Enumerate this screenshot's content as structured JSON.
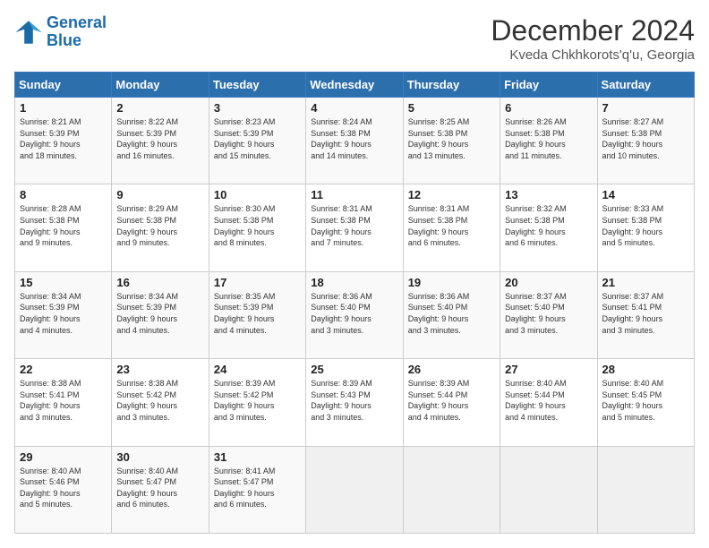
{
  "logo": {
    "general": "General",
    "blue": "Blue"
  },
  "title": "December 2024",
  "subtitle": "Kveda Chkhkorots'q'u, Georgia",
  "days_of_week": [
    "Sunday",
    "Monday",
    "Tuesday",
    "Wednesday",
    "Thursday",
    "Friday",
    "Saturday"
  ],
  "weeks": [
    [
      {
        "day": "1",
        "sunrise": "8:21 AM",
        "sunset": "5:39 PM",
        "daylight_hours": "9",
        "daylight_minutes": "18"
      },
      {
        "day": "2",
        "sunrise": "8:22 AM",
        "sunset": "5:39 PM",
        "daylight_hours": "9",
        "daylight_minutes": "16"
      },
      {
        "day": "3",
        "sunrise": "8:23 AM",
        "sunset": "5:39 PM",
        "daylight_hours": "9",
        "daylight_minutes": "15"
      },
      {
        "day": "4",
        "sunrise": "8:24 AM",
        "sunset": "5:38 PM",
        "daylight_hours": "9",
        "daylight_minutes": "14"
      },
      {
        "day": "5",
        "sunrise": "8:25 AM",
        "sunset": "5:38 PM",
        "daylight_hours": "9",
        "daylight_minutes": "13"
      },
      {
        "day": "6",
        "sunrise": "8:26 AM",
        "sunset": "5:38 PM",
        "daylight_hours": "9",
        "daylight_minutes": "11"
      },
      {
        "day": "7",
        "sunrise": "8:27 AM",
        "sunset": "5:38 PM",
        "daylight_hours": "9",
        "daylight_minutes": "10"
      }
    ],
    [
      {
        "day": "8",
        "sunrise": "8:28 AM",
        "sunset": "5:38 PM",
        "daylight_hours": "9",
        "daylight_minutes": "9"
      },
      {
        "day": "9",
        "sunrise": "8:29 AM",
        "sunset": "5:38 PM",
        "daylight_hours": "9",
        "daylight_minutes": "9"
      },
      {
        "day": "10",
        "sunrise": "8:30 AM",
        "sunset": "5:38 PM",
        "daylight_hours": "9",
        "daylight_minutes": "8"
      },
      {
        "day": "11",
        "sunrise": "8:31 AM",
        "sunset": "5:38 PM",
        "daylight_hours": "9",
        "daylight_minutes": "7"
      },
      {
        "day": "12",
        "sunrise": "8:31 AM",
        "sunset": "5:38 PM",
        "daylight_hours": "9",
        "daylight_minutes": "6"
      },
      {
        "day": "13",
        "sunrise": "8:32 AM",
        "sunset": "5:38 PM",
        "daylight_hours": "9",
        "daylight_minutes": "6"
      },
      {
        "day": "14",
        "sunrise": "8:33 AM",
        "sunset": "5:38 PM",
        "daylight_hours": "9",
        "daylight_minutes": "5"
      }
    ],
    [
      {
        "day": "15",
        "sunrise": "8:34 AM",
        "sunset": "5:39 PM",
        "daylight_hours": "9",
        "daylight_minutes": "4"
      },
      {
        "day": "16",
        "sunrise": "8:34 AM",
        "sunset": "5:39 PM",
        "daylight_hours": "9",
        "daylight_minutes": "4"
      },
      {
        "day": "17",
        "sunrise": "8:35 AM",
        "sunset": "5:39 PM",
        "daylight_hours": "9",
        "daylight_minutes": "4"
      },
      {
        "day": "18",
        "sunrise": "8:36 AM",
        "sunset": "5:40 PM",
        "daylight_hours": "9",
        "daylight_minutes": "3"
      },
      {
        "day": "19",
        "sunrise": "8:36 AM",
        "sunset": "5:40 PM",
        "daylight_hours": "9",
        "daylight_minutes": "3"
      },
      {
        "day": "20",
        "sunrise": "8:37 AM",
        "sunset": "5:40 PM",
        "daylight_hours": "9",
        "daylight_minutes": "3"
      },
      {
        "day": "21",
        "sunrise": "8:37 AM",
        "sunset": "5:41 PM",
        "daylight_hours": "9",
        "daylight_minutes": "3"
      }
    ],
    [
      {
        "day": "22",
        "sunrise": "8:38 AM",
        "sunset": "5:41 PM",
        "daylight_hours": "9",
        "daylight_minutes": "3"
      },
      {
        "day": "23",
        "sunrise": "8:38 AM",
        "sunset": "5:42 PM",
        "daylight_hours": "9",
        "daylight_minutes": "3"
      },
      {
        "day": "24",
        "sunrise": "8:39 AM",
        "sunset": "5:42 PM",
        "daylight_hours": "9",
        "daylight_minutes": "3"
      },
      {
        "day": "25",
        "sunrise": "8:39 AM",
        "sunset": "5:43 PM",
        "daylight_hours": "9",
        "daylight_minutes": "3"
      },
      {
        "day": "26",
        "sunrise": "8:39 AM",
        "sunset": "5:44 PM",
        "daylight_hours": "9",
        "daylight_minutes": "4"
      },
      {
        "day": "27",
        "sunrise": "8:40 AM",
        "sunset": "5:44 PM",
        "daylight_hours": "9",
        "daylight_minutes": "4"
      },
      {
        "day": "28",
        "sunrise": "8:40 AM",
        "sunset": "5:45 PM",
        "daylight_hours": "9",
        "daylight_minutes": "5"
      }
    ],
    [
      {
        "day": "29",
        "sunrise": "8:40 AM",
        "sunset": "5:46 PM",
        "daylight_hours": "9",
        "daylight_minutes": "5"
      },
      {
        "day": "30",
        "sunrise": "8:40 AM",
        "sunset": "5:47 PM",
        "daylight_hours": "9",
        "daylight_minutes": "6"
      },
      {
        "day": "31",
        "sunrise": "8:41 AM",
        "sunset": "5:47 PM",
        "daylight_hours": "9",
        "daylight_minutes": "6"
      },
      null,
      null,
      null,
      null
    ]
  ],
  "labels": {
    "sunrise": "Sunrise:",
    "sunset": "Sunset:",
    "daylight": "Daylight:",
    "hours": "hours",
    "and": "and",
    "minutes": "minutes."
  }
}
